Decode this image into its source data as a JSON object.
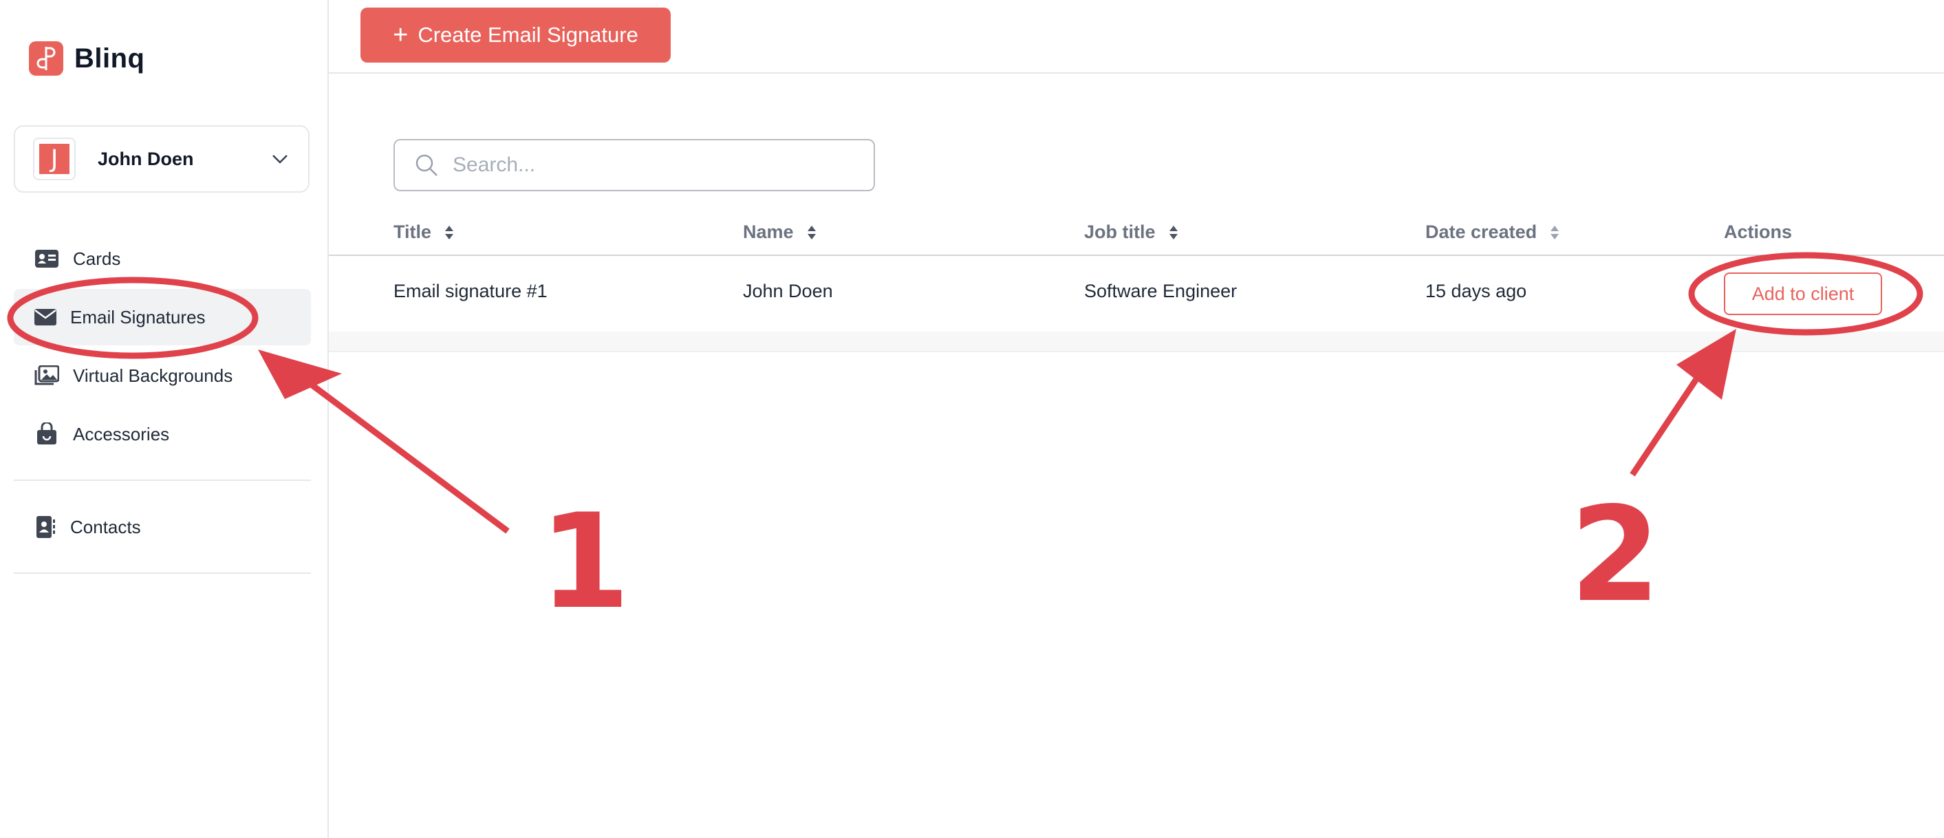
{
  "app": {
    "name": "Blinq"
  },
  "user": {
    "name": "John Doen",
    "initial": "J"
  },
  "sidebar": {
    "items": [
      {
        "label": "Cards",
        "icon": "id-card-icon"
      },
      {
        "label": "Email Signatures",
        "icon": "envelope-icon",
        "active": true
      },
      {
        "label": "Virtual Backgrounds",
        "icon": "images-icon"
      },
      {
        "label": "Accessories",
        "icon": "shopping-bag-icon"
      },
      {
        "label": "Contacts",
        "icon": "address-book-icon"
      }
    ]
  },
  "toolbar": {
    "create_label": "Create Email Signature"
  },
  "search": {
    "placeholder": "Search..."
  },
  "table": {
    "columns": [
      "Title",
      "Name",
      "Job title",
      "Date created",
      "Actions"
    ],
    "rows": [
      {
        "title": "Email signature #1",
        "name": "John Doen",
        "job_title": "Software Engineer",
        "date_created": "15 days ago",
        "action_label": "Add to client"
      }
    ]
  },
  "annotations": {
    "step1": "1",
    "step2": "2"
  },
  "colors": {
    "brand": "#e8625b",
    "annotation": "#e0424b",
    "active_bg": "#f1f2f4"
  }
}
